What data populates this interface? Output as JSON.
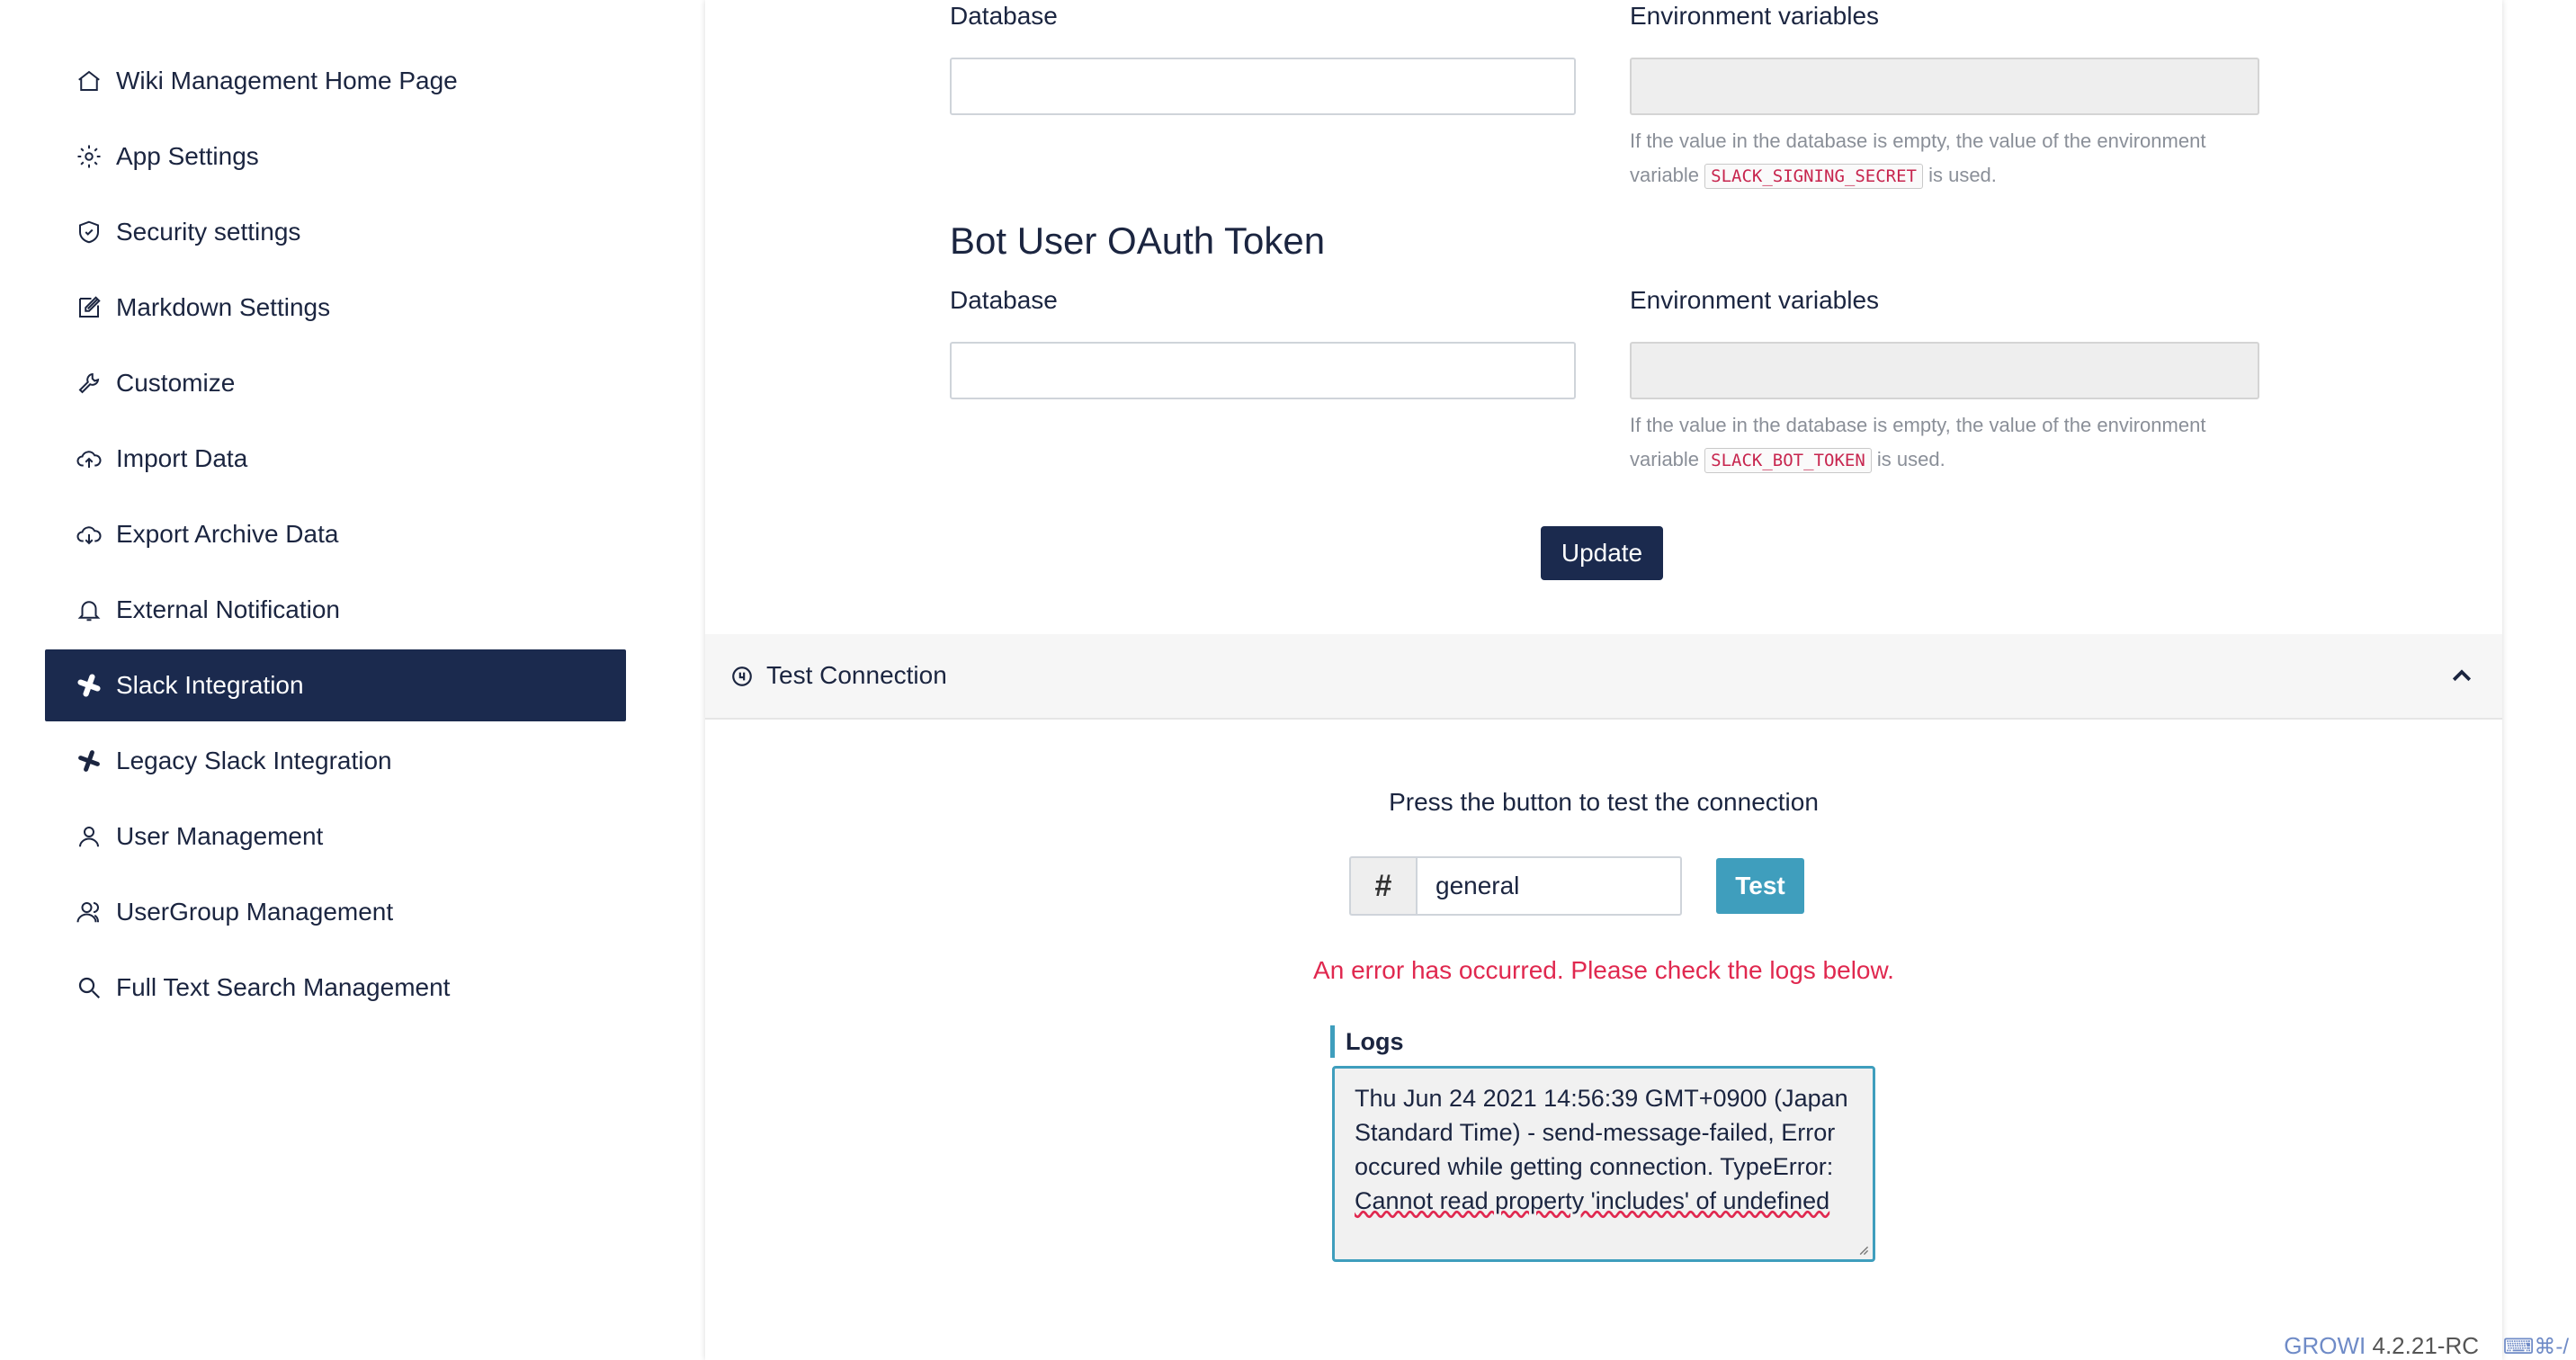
{
  "sidebar": {
    "items": [
      {
        "label": "Wiki Management Home Page",
        "icon": "home-icon"
      },
      {
        "label": "App Settings",
        "icon": "gear-icon"
      },
      {
        "label": "Security settings",
        "icon": "shield-icon"
      },
      {
        "label": "Markdown Settings",
        "icon": "edit-icon"
      },
      {
        "label": "Customize",
        "icon": "wrench-icon"
      },
      {
        "label": "Import Data",
        "icon": "cloud-upload-icon"
      },
      {
        "label": "Export Archive Data",
        "icon": "cloud-download-icon"
      },
      {
        "label": "External Notification",
        "icon": "bell-icon"
      },
      {
        "label": "Slack Integration",
        "icon": "slack-icon",
        "active": true
      },
      {
        "label": "Legacy Slack Integration",
        "icon": "slack-icon"
      },
      {
        "label": "User Management",
        "icon": "user-icon"
      },
      {
        "label": "UserGroup Management",
        "icon": "users-icon"
      },
      {
        "label": "Full Text Search Management",
        "icon": "search-icon"
      }
    ]
  },
  "signing_secret": {
    "database_label": "Database",
    "env_label": "Environment variables",
    "database_value": "",
    "env_value": "",
    "help_prefix": "If the value in the database is empty, the value of the environment variable",
    "help_code": "SLACK_SIGNING_SECRET",
    "help_suffix": "is used."
  },
  "bot_token": {
    "title": "Bot User OAuth Token",
    "database_label": "Database",
    "env_label": "Environment variables",
    "database_value": "",
    "env_value": "",
    "help_prefix": "If the value in the database is empty, the value of the environment variable",
    "help_code": "SLACK_BOT_TOKEN",
    "help_suffix": "is used."
  },
  "update_button": "Update",
  "test_connection": {
    "header": "Test Connection",
    "prompt": "Press the button to test the connection",
    "channel_prefix": "#",
    "channel_value": "general",
    "test_button": "Test",
    "error": "An error has occurred. Please check the logs below.",
    "logs_label": "Logs",
    "logs_text": "Thu Jun 24 2021 14:56:39 GMT+0900 (Japan Standard Time) - send-message-failed, Error occured while getting connection. TypeError: ",
    "logs_error": "Cannot read property 'includes' of undefined"
  },
  "footer": {
    "brand": "GROWI",
    "version": "4.2.21-RC",
    "shortcut": "⌨⌘-/"
  },
  "colors": {
    "primary": "#1b2a4e",
    "info": "#3f9ebd",
    "danger": "#e0284f"
  }
}
